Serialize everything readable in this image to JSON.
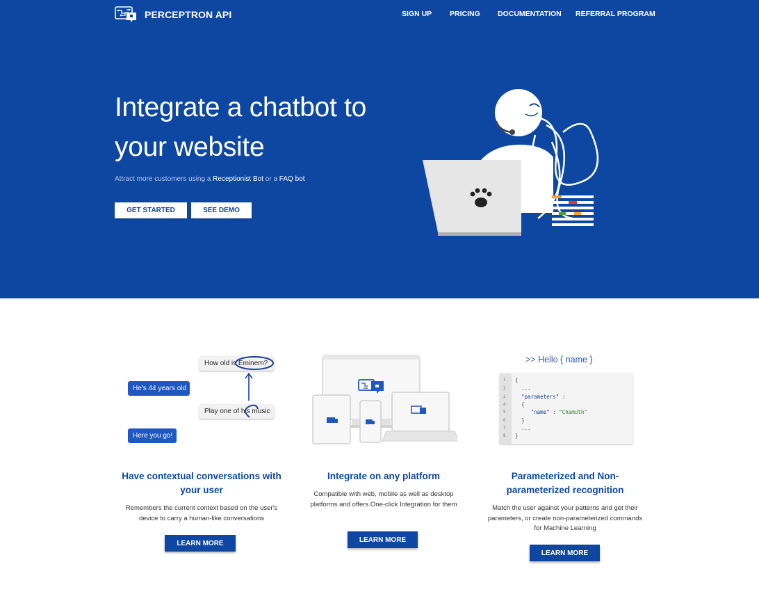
{
  "nav": {
    "brand": "PERCEPTRON API",
    "links": [
      "SIGN UP",
      "PRICING",
      "DOCUMENTATION",
      "REFERRAL PROGRAM"
    ]
  },
  "hero": {
    "title": "Integrate a chatbot to your website",
    "subtitle_pre": "Attract more customers using a ",
    "subtitle_link1": "Receptionist Bot",
    "subtitle_mid": " or a ",
    "subtitle_link2": "FAQ bot",
    "get_started": "GET STARTED",
    "see_demo": "SEE DEMO",
    "illustration_icon": "paw-icon"
  },
  "chat_demo": {
    "user_question": "How old is Eminem?",
    "bot_answer": "He's 44 years old",
    "user_request": "Play one of his music",
    "bot_reply": "Here you go!"
  },
  "code_demo": {
    "hello_prefix": ">> Hello ",
    "hello_var": "{ name }",
    "lines": [
      {
        "n": "1",
        "text": "{"
      },
      {
        "n": "2",
        "text": "  ..."
      },
      {
        "n": "3",
        "key": "  \"parameters\"",
        "rest": " :"
      },
      {
        "n": "4",
        "text": "  {"
      },
      {
        "n": "5",
        "key": "     \"name\"",
        "rest": " : ",
        "str": "\"Chamuth\""
      },
      {
        "n": "6",
        "text": "  }"
      },
      {
        "n": "7",
        "text": "  ..."
      },
      {
        "n": "8",
        "text": "}"
      }
    ]
  },
  "features": [
    {
      "title": "Have contextual conversations with your user",
      "desc": "Remembers the current context based on the user's device to carry a human-like conversations",
      "button": "LEARN MORE"
    },
    {
      "title": "Integrate on any platform",
      "desc": "Compatible with web, mobile as well as desktop platforms and offers One-click Integration for them",
      "button": "LEARN MORE"
    },
    {
      "title": "Parameterized and Non-parameterized recognition",
      "desc": "Match the user against your patterns and get their parameters, or create non-parameterized commands for Machine Learning",
      "button": "LEARN MORE"
    }
  ],
  "colors": {
    "primary": "#0d47a1",
    "white": "#ffffff"
  }
}
